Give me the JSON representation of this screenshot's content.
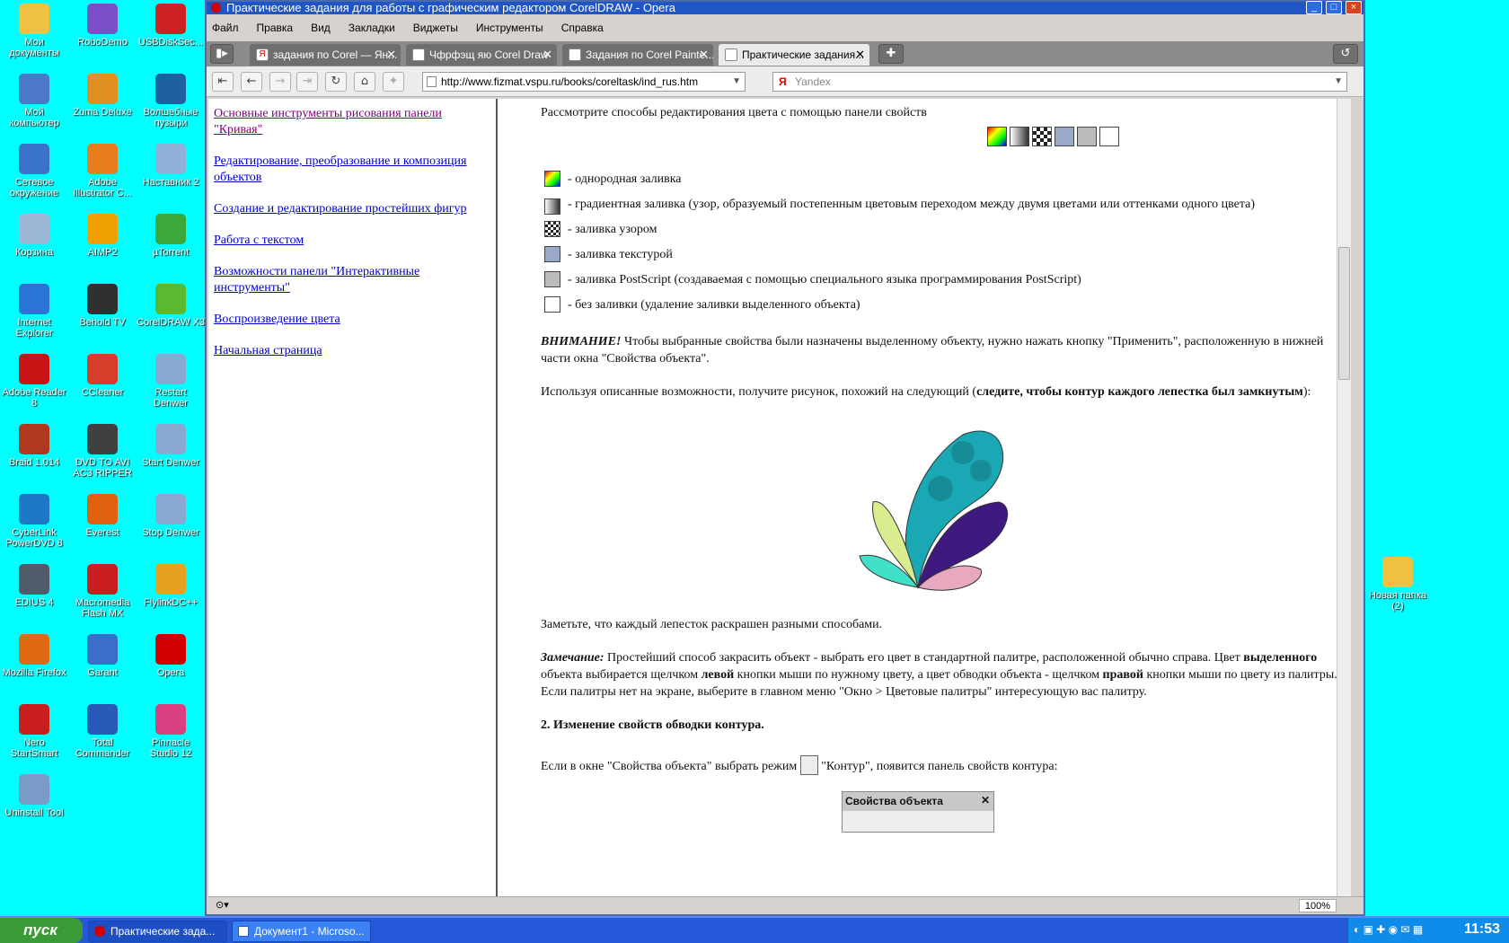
{
  "desktop_icons": [
    {
      "label": "Мои документы",
      "icon": "folder-icon",
      "color": "#f0c040"
    },
    {
      "label": "RoboDemo",
      "icon": "robodemo-icon",
      "color": "#7a4fc8"
    },
    {
      "label": "USBDiskSec...",
      "icon": "usb-icon",
      "color": "#cc2222"
    },
    {
      "label": "Мой компьютер",
      "icon": "computer-icon",
      "color": "#4c78c8"
    },
    {
      "label": "Zuma Deluxe",
      "icon": "zuma-icon",
      "color": "#e09020"
    },
    {
      "label": "Волшебные пузыри",
      "icon": "bubbles-icon",
      "color": "#2060a0"
    },
    {
      "label": "Сетевое окружение",
      "icon": "network-icon",
      "color": "#3a72c8"
    },
    {
      "label": "Adobe Illustrator C...",
      "icon": "illustrator-icon",
      "color": "#e87d1e"
    },
    {
      "label": "Наставник 2",
      "icon": "tutor-icon",
      "color": "#8fb0d8"
    },
    {
      "label": "Корзина",
      "icon": "recycle-bin-icon",
      "color": "#9cb6d6"
    },
    {
      "label": "AIMP2",
      "icon": "aimp-icon",
      "color": "#f0a000"
    },
    {
      "label": "µTorrent",
      "icon": "utorrent-icon",
      "color": "#3ca83c"
    },
    {
      "label": "Internet Explorer",
      "icon": "ie-icon",
      "color": "#2a74d8"
    },
    {
      "label": "Behold TV",
      "icon": "beholdtv-icon",
      "color": "#303030"
    },
    {
      "label": "CorelDRAW X3",
      "icon": "coreldraw-icon",
      "color": "#5cb82e"
    },
    {
      "label": "Adobe Reader 8",
      "icon": "adobe-reader-icon",
      "color": "#c81414"
    },
    {
      "label": "CCleaner",
      "icon": "ccleaner-icon",
      "color": "#d83c2a"
    },
    {
      "label": "Restart Denwer",
      "icon": "denwer-icon",
      "color": "#8aa8d0"
    },
    {
      "label": "Braid 1.014",
      "icon": "braid-icon",
      "color": "#b03820"
    },
    {
      "label": "DVD TO AVI AC3 RIPPER",
      "icon": "dvd-icon",
      "color": "#404040"
    },
    {
      "label": "Start Denwer",
      "icon": "denwer-icon",
      "color": "#8aa8d0"
    },
    {
      "label": "CyberLink PowerDVD 8",
      "icon": "powerdvd-icon",
      "color": "#1e78c8"
    },
    {
      "label": "Everest",
      "icon": "everest-icon",
      "color": "#e06010"
    },
    {
      "label": "Stop Denwer",
      "icon": "denwer-icon",
      "color": "#8aa8d0"
    },
    {
      "label": "EDIUS 4",
      "icon": "edius-icon",
      "color": "#505a68"
    },
    {
      "label": "Macromedia Flash MX",
      "icon": "flash-icon",
      "color": "#c81e1e"
    },
    {
      "label": "FlylinkDC++",
      "icon": "flylink-icon",
      "color": "#e8a020"
    },
    {
      "label": "Mozilla Firefox",
      "icon": "firefox-icon",
      "color": "#e06a14"
    },
    {
      "label": "Garant",
      "icon": "garant-icon",
      "color": "#3a6ec8"
    },
    {
      "label": "Opera",
      "icon": "opera-icon",
      "color": "#d10000"
    },
    {
      "label": "Nero StartSmart",
      "icon": "nero-icon",
      "color": "#c81e1e"
    },
    {
      "label": "Total Commander",
      "icon": "total-commander-icon",
      "color": "#2a5ab8"
    },
    {
      "label": "Pinnacle Studio 12",
      "icon": "pinnacle-icon",
      "color": "#d84080"
    },
    {
      "label": "Uninstall Tool",
      "icon": "uninstall-icon",
      "color": "#7a9ac8"
    }
  ],
  "right_folder": {
    "label": "Новая папка (2)",
    "icon": "folder-icon"
  },
  "window": {
    "title": "Практические задания для работы с графическим редактором CorelDRAW - Opera",
    "menu": [
      "Файл",
      "Правка",
      "Вид",
      "Закладки",
      "Виджеты",
      "Инструменты",
      "Справка"
    ],
    "tabs": [
      {
        "label": "задания по Corel — Ян..."
      },
      {
        "label": "Чфрфэщ яю Corel Draw"
      },
      {
        "label": "Задания по Corel Painte..."
      },
      {
        "label": "Практические задания..."
      }
    ],
    "address": "http://www.fizmat.vspu.ru/books/coreltask/ind_rus.htm",
    "search_placeholder": "Yandex",
    "zoom": "100%"
  },
  "leftnav": [
    {
      "label": "Основные инструменты рисования панели \"Кривая\""
    },
    {
      "label": "Редактирование, преобразование и композиция объектов"
    },
    {
      "label": "Создание и редактирование простейших фигур"
    },
    {
      "label": "Работа с текстом"
    },
    {
      "label": "Возможности панели \"Интерактивные инструменты\""
    },
    {
      "label": "Воспроизведение цвета"
    },
    {
      "label": "Начальная страница"
    }
  ],
  "content": {
    "intro": "Рассмотрите способы редактирования цвета с помощью панели свойств",
    "fills": [
      "- однородная заливка",
      "- градиентная заливка (узор, образуемый постепенным цветовым переходом между двумя цветами или оттенками одного цвета)",
      "- заливка узором",
      "- заливка текстурой",
      "- заливка PostScript (создаваемая с помощью специального языка программирования PostScript)",
      "- без заливки (удаление заливки выделенного объекта)"
    ],
    "attention_label": "ВНИМАНИЕ!",
    "attention_text": "Чтобы выбранные свойства были назначены выделенному объекту, нужно нажать кнопку \"Применить\", расположенную в нижней части окна \"Свойства объекта\".",
    "task_text": "Используя описанные возможности, получите рисунок, похожий на следующий (",
    "task_bold": "следите, чтобы контур каждого лепестка был замкнутым",
    "task_end": "):",
    "note_after_picture": "Заметьте, что каждый лепесток раскрашен разными способами.",
    "remark_label": "Замечание:",
    "remark_1": "Простейший способ закрасить объект - выбрать его цвет в стандартной палитре, расположенной обычно справа. Цвет",
    "remark_bold1": "выделенного",
    "remark_2": "объекта выбирается щелчком",
    "remark_bold2": "левой",
    "remark_3": "кнопки мыши по нужному цвету, а цвет обводки объекта - щелчком",
    "remark_bold3": "правой",
    "remark_4": "кнопки мыши по цвету из палитры.",
    "palette_hint": "Если палитры нет на экране, выберите в главном меню \"Окно > Цветовые палитры\" интересующую вас палитру.",
    "section2": "2.  Изменение свойств обводки контура.",
    "outline_text_1": "Если в окне \"Свойства объекта\" выбрать режим",
    "outline_text_2": "\"Контур\", появится панель свойств контура:",
    "panel_title": "Свойства объекта"
  },
  "taskbar": {
    "start": "пуск",
    "tasks": [
      "Практические зада...",
      "Документ1 - Microso..."
    ],
    "clock": "11:53"
  }
}
